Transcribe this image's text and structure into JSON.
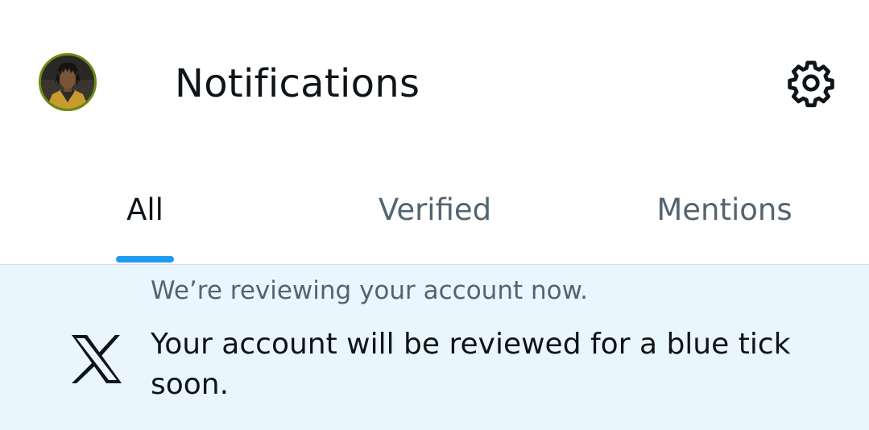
{
  "header": {
    "title": "Notifications",
    "avatar_icon": "user-avatar",
    "settings_icon": "gear-icon"
  },
  "tabs": [
    {
      "label": "All",
      "active": true
    },
    {
      "label": "Verified",
      "active": false
    },
    {
      "label": "Mentions",
      "active": false
    }
  ],
  "notification": {
    "icon": "x-logo-icon",
    "subtitle": "We’re reviewing your account now.",
    "text": "Your account will be reviewed for a blue tick soon."
  },
  "colors": {
    "accent": "#1d9bf0",
    "text_primary": "#0f1419",
    "text_secondary": "#536471",
    "notification_bg": "#eaf6fd",
    "avatar_ring": "#6b8a12"
  }
}
